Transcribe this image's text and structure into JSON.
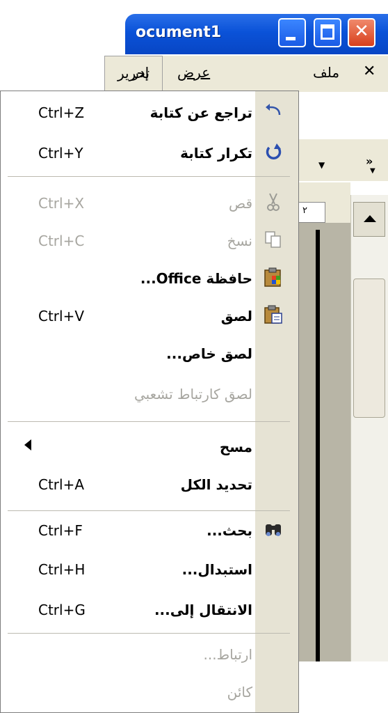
{
  "window": {
    "title": "ocument1"
  },
  "menubar": {
    "close_symbol": "✕",
    "file": "ملف",
    "edit": "تحرير",
    "view": "عرض",
    "insert": "إدر"
  },
  "ruler": {
    "marker": "٢"
  },
  "edit_menu": {
    "items": [
      {
        "label": "تراجع عن كتابة",
        "shortcut": "Ctrl+Z",
        "icon": "undo-icon",
        "enabled": true
      },
      {
        "label": "تكرار كتابة",
        "shortcut": "Ctrl+Y",
        "icon": "redo-icon",
        "enabled": true
      },
      {
        "label": "قص",
        "shortcut": "Ctrl+X",
        "icon": "cut-icon",
        "enabled": false
      },
      {
        "label": "نسخ",
        "shortcut": "Ctrl+C",
        "icon": "copy-icon",
        "enabled": false
      },
      {
        "label": "حافظة Office...",
        "shortcut": "",
        "icon": "office-clipboard-icon",
        "enabled": true
      },
      {
        "label": "لصق",
        "shortcut": "Ctrl+V",
        "icon": "paste-icon",
        "enabled": true
      },
      {
        "label": "لصق خاص...",
        "shortcut": "",
        "icon": "",
        "enabled": true
      },
      {
        "label": "لصق كارتباط تشعبي",
        "shortcut": "",
        "icon": "",
        "enabled": false
      },
      {
        "label": "مسح",
        "shortcut": "",
        "icon": "",
        "enabled": true,
        "submenu": true
      },
      {
        "label": "تحديد الكل",
        "shortcut": "Ctrl+A",
        "icon": "",
        "enabled": true
      },
      {
        "label": "بحث...",
        "shortcut": "Ctrl+F",
        "icon": "binoculars-icon",
        "enabled": true
      },
      {
        "label": "استبدال...",
        "shortcut": "Ctrl+H",
        "icon": "",
        "enabled": true
      },
      {
        "label": "الانتقال إلى...",
        "shortcut": "Ctrl+G",
        "icon": "",
        "enabled": true
      },
      {
        "label": "ارتباط...",
        "shortcut": "",
        "icon": "",
        "enabled": false
      },
      {
        "label": "كائن",
        "shortcut": "",
        "icon": "",
        "enabled": false
      }
    ]
  },
  "colors": {
    "menu_icon_strip": "#e6e3d4",
    "titlebar": "#0a52d8",
    "disabled_text": "#a7a6a0"
  }
}
